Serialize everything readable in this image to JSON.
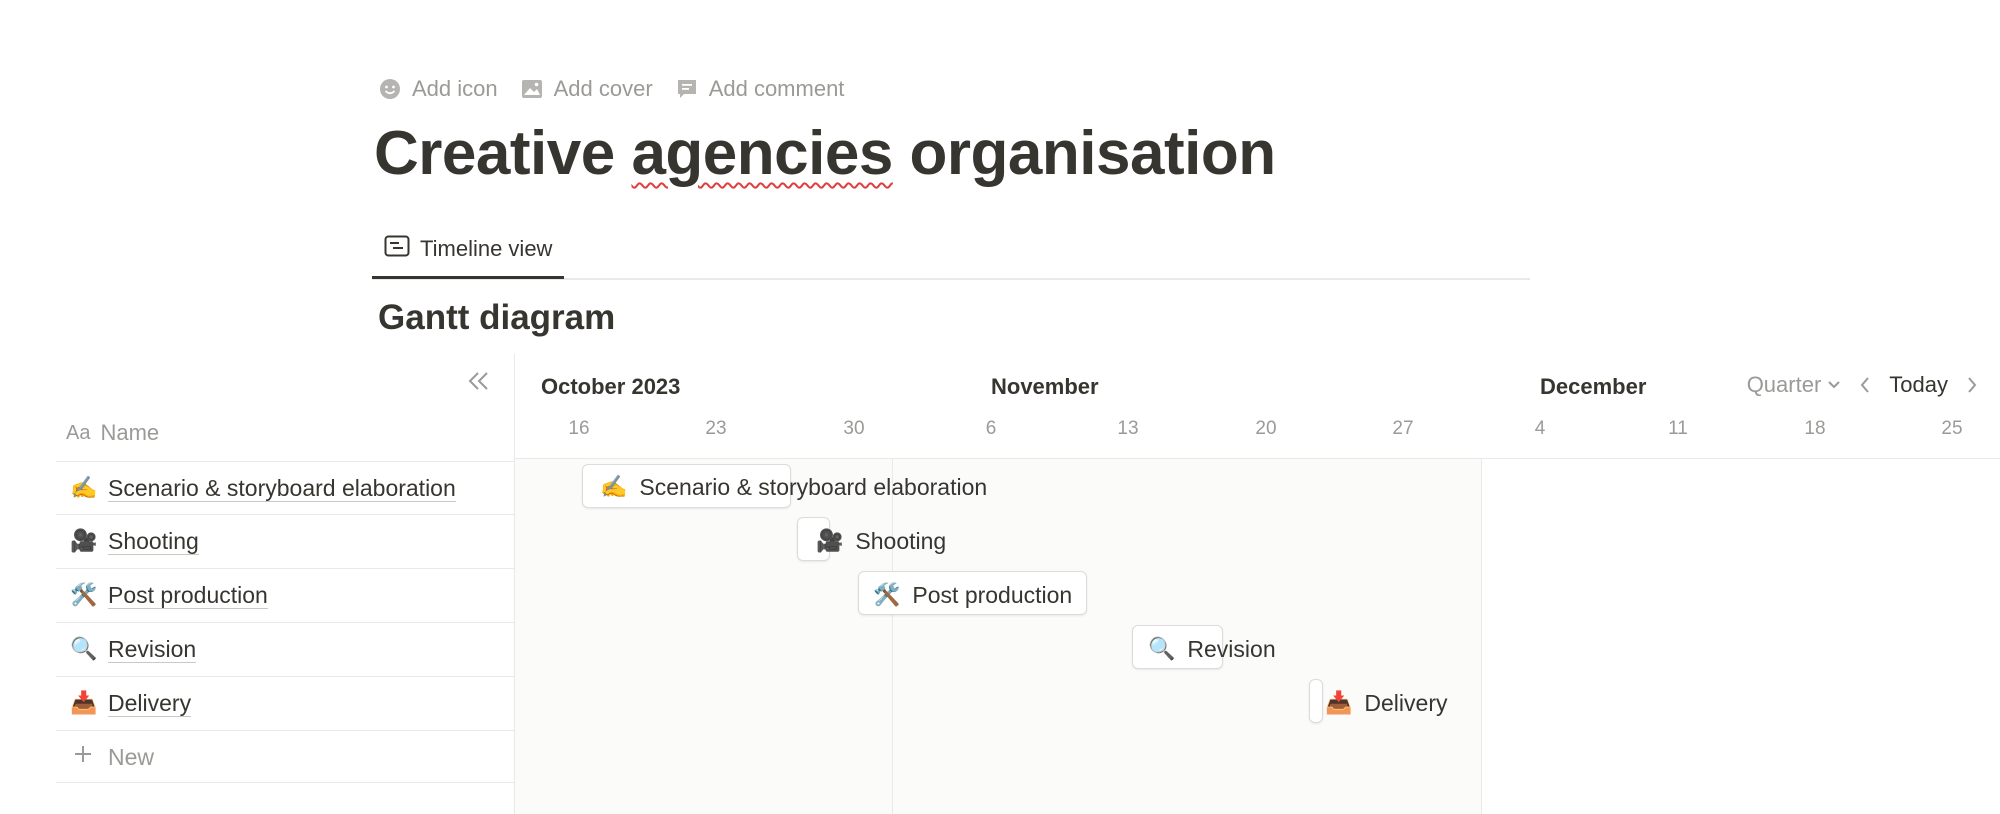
{
  "actions": [
    {
      "label": "Add icon",
      "icon": "smile-icon"
    },
    {
      "label": "Add cover",
      "icon": "image-icon"
    },
    {
      "label": "Add comment",
      "icon": "comment-icon"
    }
  ],
  "title": {
    "pre": "Creative ",
    "misspelled": "agencies",
    "post": " organisation"
  },
  "tab": {
    "label": "Timeline view",
    "icon": "timeline-icon"
  },
  "section_title": "Gantt diagram",
  "table": {
    "name_header": "Name",
    "name_prefix": "Aa",
    "rows": [
      {
        "emoji": "✍️",
        "label": "Scenario & storyboard elaboration"
      },
      {
        "emoji": "🎥",
        "label": "Shooting"
      },
      {
        "emoji": "🛠️",
        "label": "Post production"
      },
      {
        "emoji": "🔍",
        "label": "Revision"
      },
      {
        "emoji": "📥",
        "label": "Delivery"
      }
    ],
    "new_label": "New"
  },
  "timeline": {
    "months": [
      "October 2023",
      "November",
      "December"
    ],
    "days": [
      "16",
      "23",
      "30",
      "6",
      "13",
      "20",
      "27",
      "4",
      "11",
      "18",
      "25"
    ],
    "controls": {
      "period": "Quarter",
      "today": "Today"
    }
  },
  "tasks": [
    {
      "emoji": "✍️",
      "label": "Scenario & storyboard elaboration"
    },
    {
      "emoji": "🎥",
      "label": "Shooting"
    },
    {
      "emoji": "🛠️",
      "label": "Post production"
    },
    {
      "emoji": "🔍",
      "label": "Revision"
    },
    {
      "emoji": "📥",
      "label": "Delivery"
    }
  ]
}
